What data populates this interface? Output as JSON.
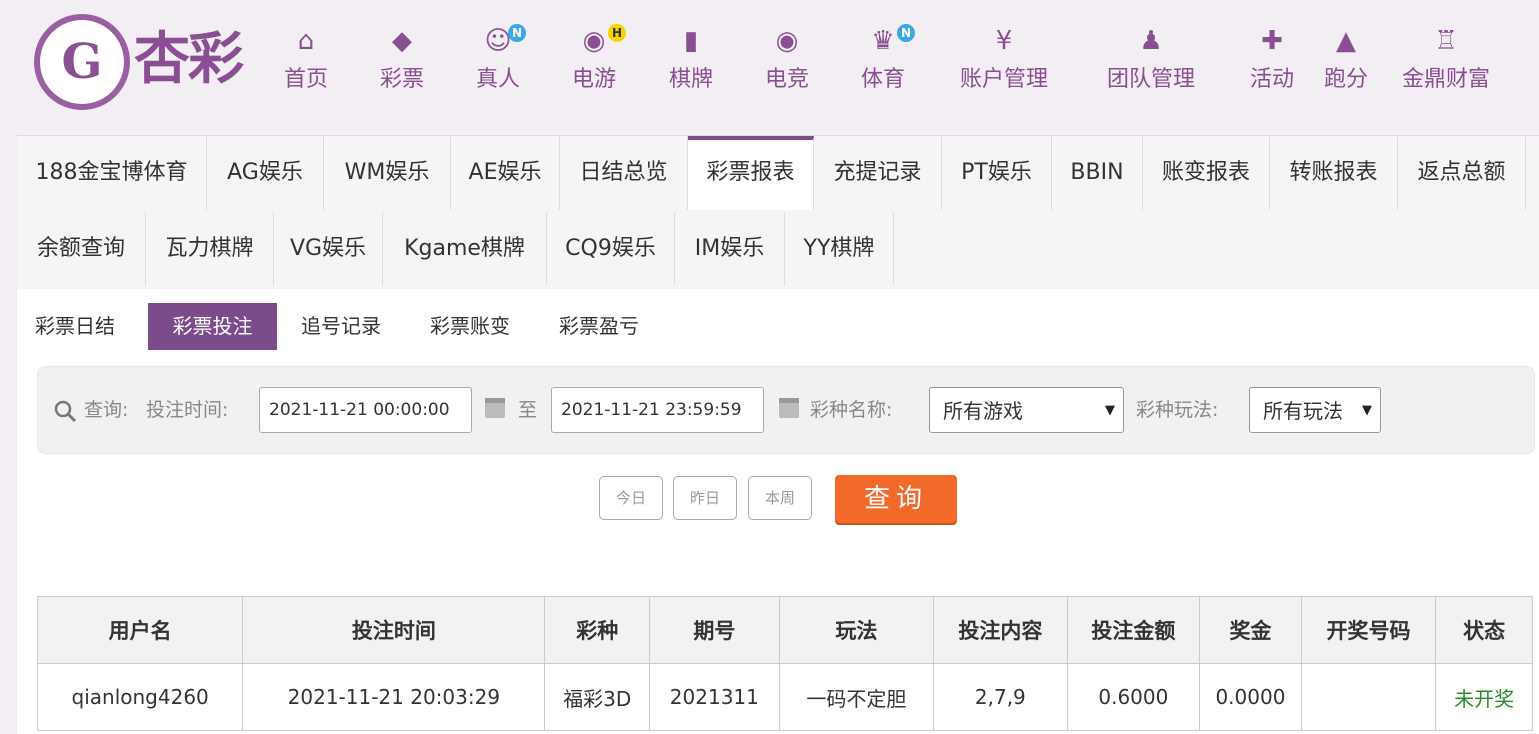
{
  "header": {
    "logo_mark": "G",
    "logo_text": "杏彩",
    "nav": [
      {
        "label": "首页",
        "icon": "home-icon",
        "glyph": "⌂"
      },
      {
        "label": "彩票",
        "icon": "ticket-icon",
        "glyph": "◆"
      },
      {
        "label": "真人",
        "icon": "live-dealer-icon",
        "glyph": "☺",
        "badge": "N"
      },
      {
        "label": "电游",
        "icon": "gamepad-icon",
        "glyph": "◉",
        "badge": "H"
      },
      {
        "label": "棋牌",
        "icon": "cards-icon",
        "glyph": "▮"
      },
      {
        "label": "电竞",
        "icon": "esports-controller-icon",
        "glyph": "◉"
      },
      {
        "label": "体育",
        "icon": "trophy-icon",
        "glyph": "♛",
        "badge": "N"
      },
      {
        "label": "账户管理",
        "icon": "yen-coin-icon",
        "glyph": "¥"
      },
      {
        "label": "团队管理",
        "icon": "team-icon",
        "glyph": "♟"
      },
      {
        "label": "活动",
        "icon": "gift-icon",
        "glyph": "✚"
      },
      {
        "label": "跑分",
        "icon": "chart-icon",
        "glyph": "▲"
      },
      {
        "label": "金鼎财富",
        "icon": "ding-vessel-icon",
        "glyph": "♖"
      }
    ]
  },
  "tabs": {
    "row1": [
      "188金宝博体育",
      "AG娱乐",
      "WM娱乐",
      "AE娱乐",
      "日结总览",
      "彩票报表",
      "充提记录",
      "PT娱乐",
      "BBIN",
      "账变报表",
      "转账报表",
      "返点总额"
    ],
    "row2": [
      "余额查询",
      "瓦力棋牌",
      "VG娱乐",
      "Kgame棋牌",
      "CQ9娱乐",
      "IM娱乐",
      "YY棋牌"
    ],
    "active": "彩票报表"
  },
  "subtabs": [
    "彩票日结",
    "彩票投注",
    "追号记录",
    "彩票账变",
    "彩票盈亏"
  ],
  "query": {
    "label": "查询:",
    "time_label": "投注时间:",
    "start_time": "2021-11-21 00:00:00",
    "to": "至",
    "end_time": "2021-11-21 23:59:59",
    "game_label": "彩种名称:",
    "game_value": "所有游戏",
    "play_label": "彩种玩法:",
    "play_value": "所有玩法",
    "buttons": [
      "今日",
      "昨日",
      "本周"
    ],
    "search": "查询"
  },
  "table": {
    "headers": [
      "用户名",
      "投注时间",
      "彩种",
      "期号",
      "玩法",
      "投注内容",
      "投注金额",
      "奖金",
      "开奖号码",
      "状态"
    ],
    "rows": [
      [
        "qianlong4260",
        "2021-11-21 20:03:29",
        "福彩3D",
        "2021311",
        "一码不定胆",
        "2,7,9",
        "0.6000",
        "0.0000",
        "",
        "未开奖"
      ]
    ]
  },
  "colors": {
    "brand_purple": "#7b4b8a",
    "search_orange": "#f26a2a",
    "status_green": "#2a8a2a"
  }
}
